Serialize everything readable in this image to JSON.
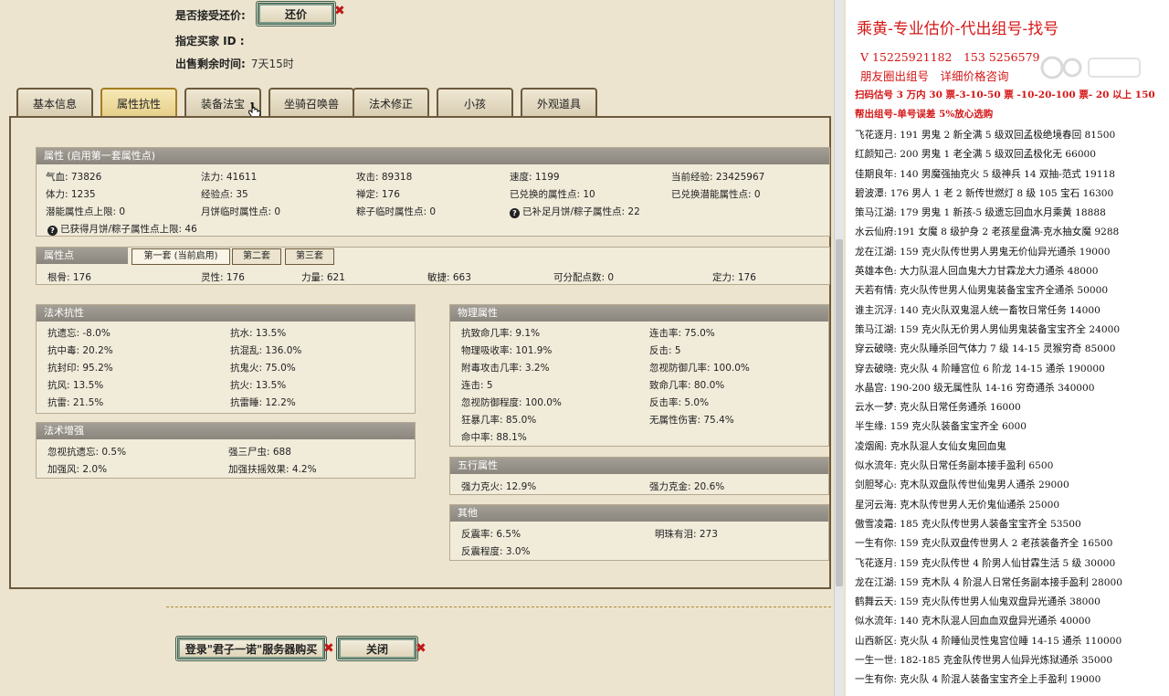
{
  "game": {
    "accept_counter_label": "是否接受还价:",
    "counter_button": "还价",
    "buyer_label": "指定买家 ID :",
    "buyer_value": "",
    "remaining_label": "出售剩余时间:",
    "remaining_value": "7天15时",
    "tabs": [
      "基本信息",
      "属性抗性",
      "装备法宝",
      "坐骑召唤兽",
      "法术修正",
      "小孩",
      "外观道具"
    ],
    "active_tab": "属性抗性",
    "attr": {
      "title": "属性 (启用第一套属性点)",
      "rows": [
        [
          "气血: 73826",
          "法力: 41611",
          "攻击: 89318",
          "速度: 1199",
          "当前经验: 23425967"
        ],
        [
          "体力: 1235",
          "经验点: 35",
          "禅定: 176",
          "已兑换的属性点: 10",
          "已兑换潜能属性点: 0"
        ],
        [
          "潜能属性点上限: 0",
          "月饼临时属性点: 0",
          "粽子临时属性点: 0",
          "已补足月饼/粽子属性点: 22",
          ""
        ]
      ],
      "footer": "已获得月饼/粽子属性点上限: 46"
    },
    "points": {
      "title": "属性点",
      "subtabs": [
        "第一套 (当前启用)",
        "第二套",
        "第三套"
      ],
      "row": [
        "根骨: 176",
        "灵性: 176",
        "力量: 621",
        "敏捷: 663",
        "可分配点数: 0",
        "定力: 176"
      ]
    },
    "resist": {
      "title": "法术抗性",
      "rows": [
        [
          "抗遗忘: -8.0%",
          "抗水: 13.5%"
        ],
        [
          "抗中毒: 20.2%",
          "抗混乱: 136.0%"
        ],
        [
          "抗封印: 95.2%",
          "抗鬼火: 75.0%"
        ],
        [
          "抗风: 13.5%",
          "抗火: 13.5%"
        ],
        [
          "抗雷: 21.5%",
          "抗雷睡: 12.2%"
        ]
      ]
    },
    "enhance": {
      "title": "法术增强",
      "rows": [
        [
          "忽视抗遗忘: 0.5%",
          "强三尸虫: 688"
        ],
        [
          "加强风: 2.0%",
          "加强扶摇效果: 4.2%"
        ]
      ]
    },
    "physical": {
      "title": "物理属性",
      "rows": [
        [
          "抗致命几率: 9.1%",
          "连击率: 75.0%"
        ],
        [
          "物理吸收率: 101.9%",
          "反击: 5"
        ],
        [
          "附毒攻击几率: 3.2%",
          "忽视防御几率: 100.0%"
        ],
        [
          "连击: 5",
          "致命几率: 80.0%"
        ],
        [
          "忽视防御程度: 100.0%",
          "反击率: 5.0%"
        ],
        [
          "狂暴几率: 85.0%",
          "无属性伤害: 75.4%"
        ],
        [
          "命中率: 88.1%",
          ""
        ]
      ]
    },
    "five": {
      "title": "五行属性",
      "rows": [
        [
          "强力克火: 12.9%",
          "强力克金: 20.6%"
        ]
      ]
    },
    "other": {
      "title": "其他",
      "rows": [
        [
          "反震率: 6.5%",
          "明珠有泪: 273"
        ],
        [
          "反震程度: 3.0%",
          ""
        ]
      ]
    },
    "login_button": "登录\"君子一诺\"服务器购买",
    "close_button": "关闭"
  },
  "side": {
    "title": "乘黄-专业估价-代出组号-找号",
    "phone": "V 15225921182　153 5256579",
    "circle": "朋友圈出组号　详细价格咨询",
    "price_line": "扫码估号 3 万内 30 票-3-10-50 票 -10-20-100 票- 20 以上 150",
    "error_line": "帮出组号-单号误差 5%放心选购",
    "list": [
      "飞花逐月: 191 男鬼 2 新全满 5 级双回孟极绝境春回 81500",
      "红颜知己: 200 男鬼 1 老全满 5 级双回孟极化无 66000",
      "佳期良年: 140 男魔强抽克火 5 级神兵 14 双抽-范式 19118",
      "碧波潭: 176 男人 1 老 2 新传世燃灯 8 级 105 宝石 16300",
      "策马江湖: 179 男鬼 1 新孩-5 级遗忘回血水月乘黄 18888",
      "水云仙府:191 女魔 8 级护身 2 老孩星盘满-克水抽女魔 9288",
      "龙在江湖: 159 克火队传世男人男鬼无价仙异光通杀 19000",
      "英雄本色: 大力队混人回血鬼大力甘霖龙大力通杀 48000",
      "天若有情: 克火队传世男人仙男鬼装备宝宝齐全通杀 50000",
      "谁主沉浮: 140 克火队双鬼混人统一畜牧日常任务 14000",
      "策马江湖: 159 克火队无价男人男仙男鬼装备宝宝齐全 24000",
      "穿云破晓: 克火队睡杀回气体力 7 级 14-15 灵猴穷奇 85000",
      "穿去破晓: 克火队 4 阶睡宫位 6 阶龙 14-15 通杀 190000",
      "水晶宫: 190-200 级无属性队 14-16 穷奇通杀 340000",
      "云水一梦: 克火队日常任务通杀 16000",
      "半生缘: 159 克火队装备宝宝齐全 6000",
      "凌烟阁: 克水队混人女仙女鬼回血鬼",
      "似水流年: 克火队日常任务副本接手盈利 6500",
      "剑胆琴心: 克木队双盘队传世仙鬼男人通杀 29000",
      "星河云海: 克木队传世男人无价鬼仙通杀 25000",
      "傲雪凌霜: 185 克火队传世男人装备宝宝齐全 53500",
      "一生有你: 159 克火队双盘传世男人 2 老孩装备齐全 16500",
      "飞花逐月: 159 克火队传世 4 阶男人仙甘霖生活 5 级 30000",
      "龙在江湖: 159 克木队 4 阶混人日常任务副本接手盈利 28000",
      "鹤舞云天: 159 克火队传世男人仙鬼双盘异光通杀 38000",
      "似水流年: 140 克木队混人回血血双盘异光通杀 40000",
      "山西新区: 克火队 4 阶睡仙灵性鬼宫位睡 14-15 通杀 110000",
      "一生一世: 182-185 克金队传世男人仙异光炼狱通杀 35000",
      "一生有你: 克火队 4 阶混人装备宝宝齐全上手盈利 19000"
    ]
  }
}
